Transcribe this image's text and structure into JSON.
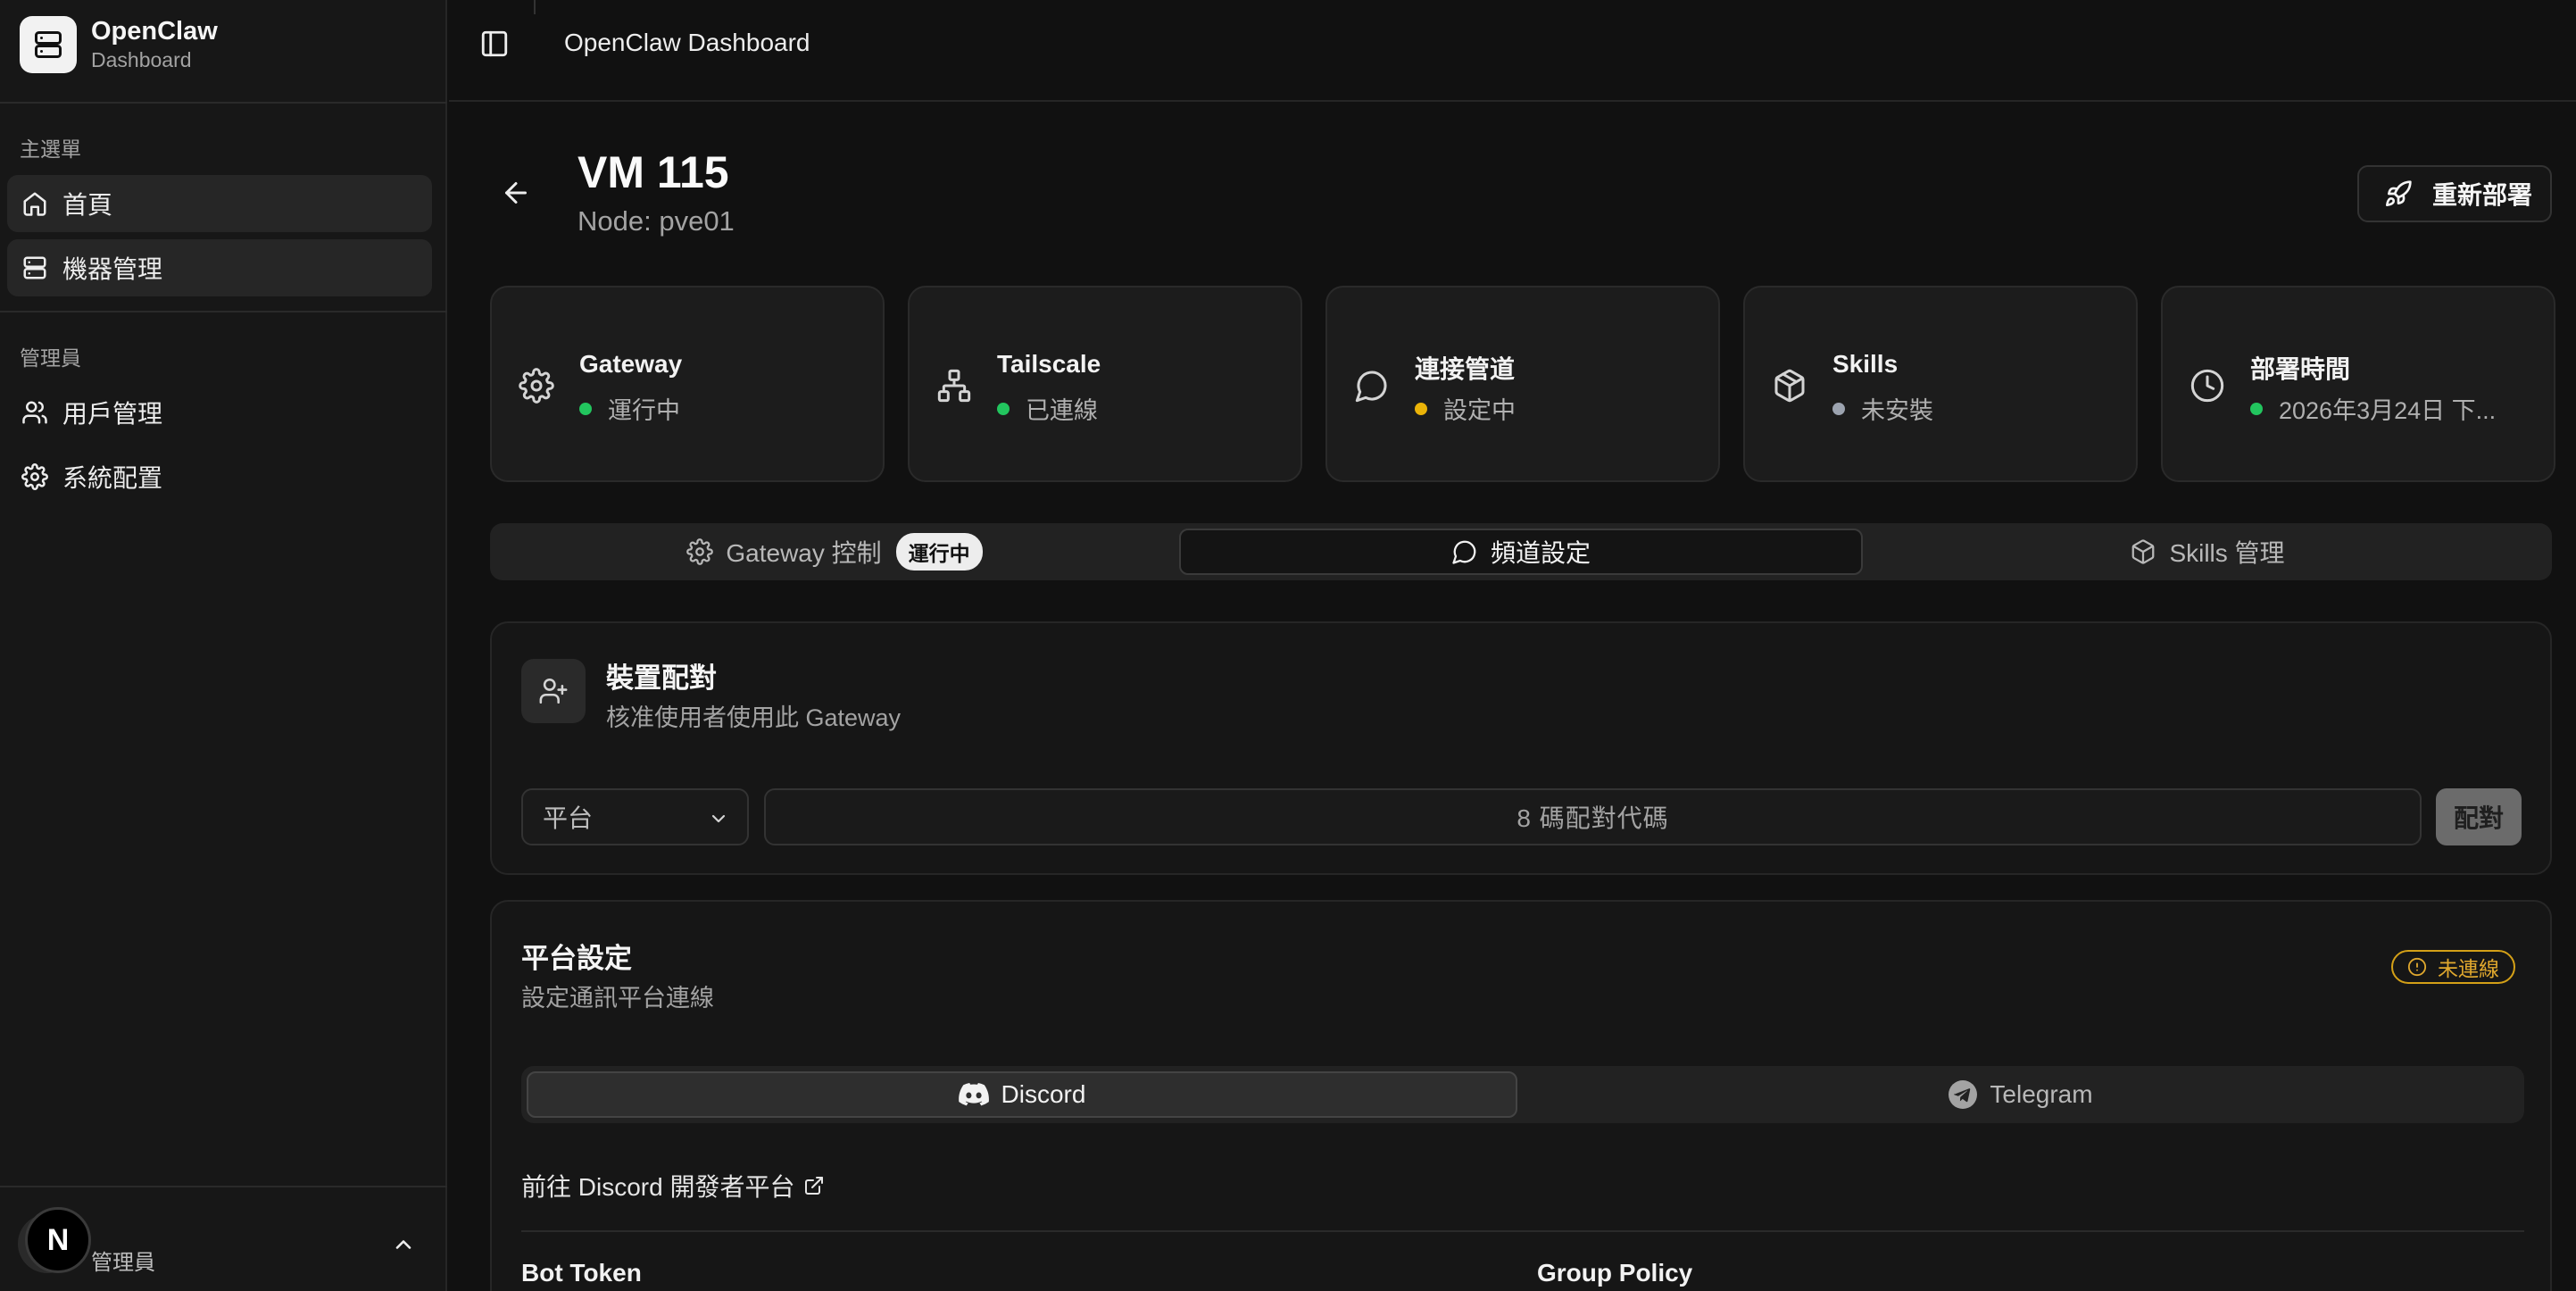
{
  "brand": {
    "name": "OpenClaw",
    "subtitle": "Dashboard"
  },
  "sidebar": {
    "main_group": "主選單",
    "main_items": [
      {
        "label": "首頁",
        "icon": "home-icon"
      },
      {
        "label": "機器管理",
        "icon": "server-icon"
      }
    ],
    "admin_group": "管理員",
    "admin_items": [
      {
        "label": "用戶管理",
        "icon": "users-icon"
      },
      {
        "label": "系統配置",
        "icon": "gear-icon"
      }
    ],
    "user": {
      "avatar_letter": "N",
      "role": "管理員"
    }
  },
  "header": {
    "title": "OpenClaw Dashboard"
  },
  "vm": {
    "name": "VM 115",
    "node": "Node: pve01",
    "redeploy_label": "重新部署"
  },
  "status_cards": [
    {
      "label": "Gateway",
      "status": "運行中",
      "status_color": "#22c55e",
      "icon": "gear-icon"
    },
    {
      "label": "Tailscale",
      "status": "已連線",
      "status_color": "#22c55e",
      "icon": "network-icon"
    },
    {
      "label": "連接管道",
      "status": "設定中",
      "status_color": "#eab308",
      "icon": "chat-icon"
    },
    {
      "label": "Skills",
      "status": "未安裝",
      "status_color": "#9ca3af",
      "icon": "package-icon"
    },
    {
      "label": "部署時間",
      "status": "2026年3月24日 下...",
      "status_color": "#22c55e",
      "icon": "clock-icon"
    }
  ],
  "tabs": [
    {
      "label": "Gateway 控制",
      "badge": "運行中",
      "icon": "gear-icon"
    },
    {
      "label": "頻道設定",
      "icon": "chat-icon",
      "active": true
    },
    {
      "label": "Skills 管理",
      "icon": "package-icon"
    }
  ],
  "pairing": {
    "title": "裝置配對",
    "subtitle": "核准使用者使用此 Gateway",
    "platform_select": "平台",
    "code_placeholder": "8  碼配對代碼",
    "button": "配對"
  },
  "platform": {
    "title": "平台設定",
    "subtitle": "設定通訊平台連線",
    "status_badge": "未連線",
    "tabs": [
      {
        "label": "Discord",
        "icon": "discord-icon",
        "active": true
      },
      {
        "label": "Telegram",
        "icon": "telegram-icon"
      }
    ],
    "dev_link": "前往 Discord 開發者平台",
    "fields": {
      "bot_token_label": "Bot Token",
      "group_policy_label": "Group Policy"
    }
  }
}
